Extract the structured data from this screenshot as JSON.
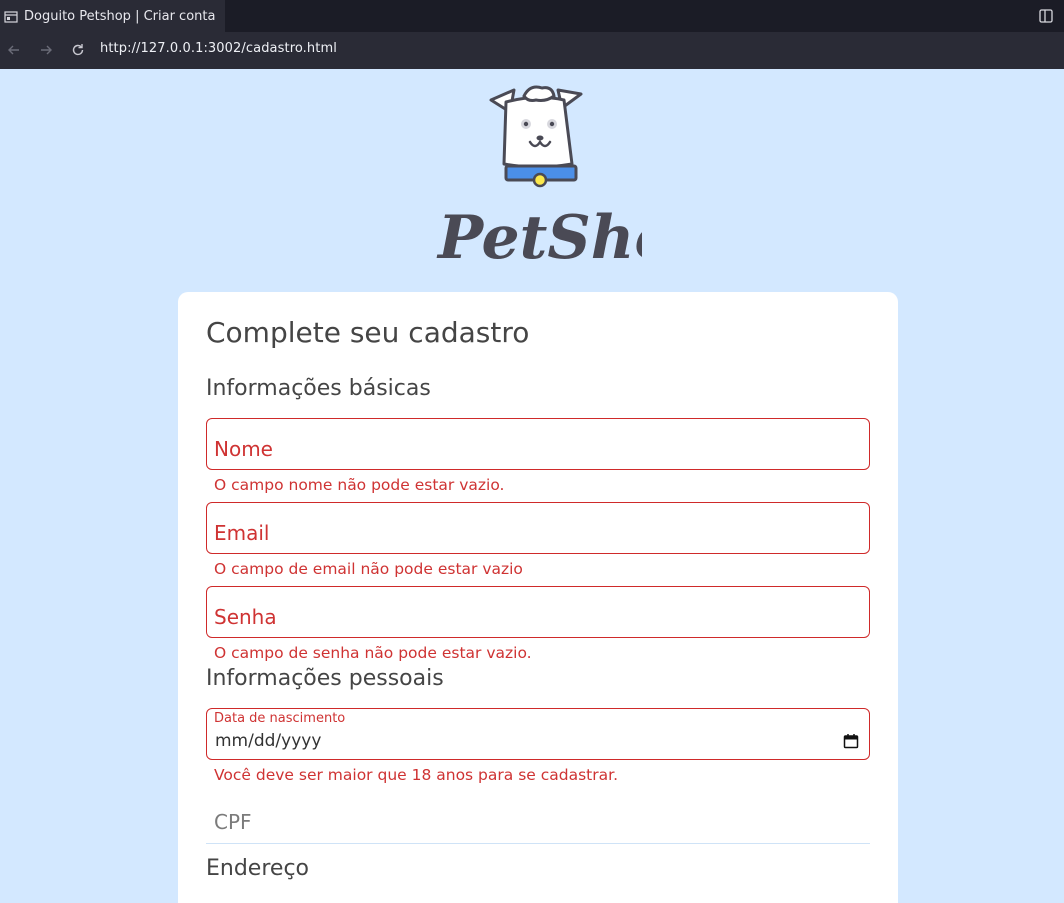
{
  "browser": {
    "tab_title": "Doguito Petshop | Criar conta",
    "url": "http://127.0.0.1:3002/cadastro.html"
  },
  "brand": {
    "name": "PetShop"
  },
  "form": {
    "title": "Complete seu cadastro",
    "section_basic": "Informações básicas",
    "nome_placeholder": "Nome",
    "nome_error": "O campo nome não pode estar vazio.",
    "email_placeholder": "Email",
    "email_error": "O campo de email não pode estar vazio",
    "senha_placeholder": "Senha",
    "senha_error": "O campo de senha não pode estar vazio.",
    "section_personal": "Informações pessoais",
    "nascimento_label": "Data de nascimento",
    "nascimento_value": "mm/dd/yyyy",
    "nascimento_error": "Você deve ser maior que 18 anos para se cadastrar.",
    "cpf_placeholder": "CPF",
    "section_address": "Endereço"
  },
  "colors": {
    "page_bg": "#d3e8ff",
    "error": "#cf3333",
    "text": "#454545"
  }
}
